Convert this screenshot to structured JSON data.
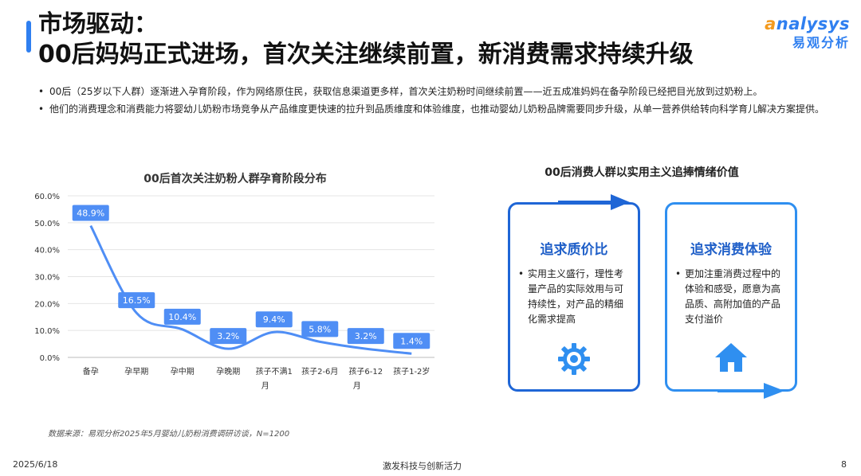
{
  "title": {
    "line1": "市场驱动：",
    "line2": "00后妈妈正式进场，首次关注继续前置，新消费需求持续升级"
  },
  "logo": {
    "en_a": "a",
    "en_rest": "nalysys",
    "cn": "易观分析"
  },
  "bullets": [
    "00后（25岁以下人群）逐渐进入孕育阶段，作为网络原住民，获取信息渠道更多样，首次关注奶粉时间继续前置——近五成准妈妈在备孕阶段已经把目光放到过奶粉上。",
    "他们的消费理念和消费能力将婴幼儿奶粉市场竞争从产品维度更快速的拉升到品质维度和体验维度，也推动婴幼儿奶粉品牌需要同步升级，从单一营养供给转向科学育儿解决方案提供。"
  ],
  "chart_data": {
    "type": "line",
    "title": "00后首次关注奶粉人群孕育阶段分布",
    "categories": [
      "备孕",
      "孕早期",
      "孕中期",
      "孕晚期",
      "孩子不满1月",
      "孩子2-6月",
      "孩子6-12月",
      "孩子1-2岁"
    ],
    "category_labels": [
      [
        "备孕"
      ],
      [
        "孕早期"
      ],
      [
        "孕中期"
      ],
      [
        "孕晚期"
      ],
      [
        "孩子不满1",
        "月"
      ],
      [
        "孩子2-6月"
      ],
      [
        "孩子6-12",
        "月"
      ],
      [
        "孩子1-2岁"
      ]
    ],
    "values": [
      48.9,
      16.5,
      10.4,
      3.2,
      9.4,
      5.8,
      3.2,
      1.4
    ],
    "value_labels": [
      "48.9%",
      "16.5%",
      "10.4%",
      "3.2%",
      "9.4%",
      "5.8%",
      "3.2%",
      "1.4%"
    ],
    "y_ticks": [
      "0.0%",
      "10.0%",
      "20.0%",
      "30.0%",
      "40.0%",
      "50.0%",
      "60.0%"
    ],
    "ylim": [
      0,
      60
    ],
    "grid": true,
    "line_color": "#4f8ef5",
    "label_bg": "#4f8ef5"
  },
  "source": "数据来源：易观分析2025年5月婴幼儿奶粉消费调研访谈，N=1200",
  "right": {
    "title": "00后消费人群以实用主义追捧情绪价值",
    "cards": [
      {
        "heading": "追求质价比",
        "text": "实用主义盛行，理性考量产品的实际效用与可持续性，对产品的精细化需求提高",
        "icon": "gear-icon"
      },
      {
        "heading": "追求消费体验",
        "text": "更加注重消费过程中的体验和感受，愿意为高品质、高附加值的产品支付溢价",
        "icon": "house-icon"
      }
    ]
  },
  "footer": {
    "date": "2025/6/18",
    "center": "激发科技与创新活力",
    "page": "8"
  },
  "colors": {
    "accent": "#2f7ff0",
    "orange": "#f39a1e"
  }
}
